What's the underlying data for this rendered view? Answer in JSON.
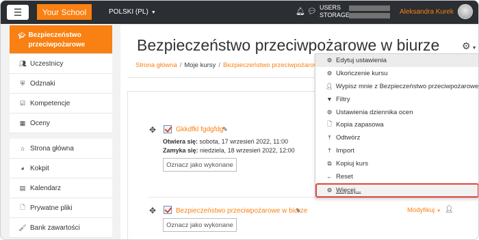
{
  "navbar": {
    "brand": "Your School",
    "language": "POLSKI (PL)",
    "usage_labels": [
      "USERS",
      "STORAGE"
    ],
    "username": "Aleksandra Kurek",
    "icons": {
      "menu": "hamburger-icon",
      "notifications": "bell-icon",
      "messages": "chat-icon"
    }
  },
  "sidebar": {
    "items": [
      {
        "label": "Bezpieczeństwo przeciwpożarowe",
        "icon": "graduation-cap-icon",
        "active": true
      },
      {
        "label": "Uczestnicy",
        "icon": "users-icon"
      },
      {
        "label": "Odznaki",
        "icon": "shield-icon"
      },
      {
        "label": "Kompetencje",
        "icon": "checkbox-icon"
      },
      {
        "label": "Oceny",
        "icon": "table-icon"
      },
      {
        "label": "Strona główna",
        "icon": "home-icon"
      },
      {
        "label": "Kokpit",
        "icon": "dashboard-icon"
      },
      {
        "label": "Kalendarz",
        "icon": "calendar-icon"
      },
      {
        "label": "Prywatne pliki",
        "icon": "file-icon"
      },
      {
        "label": "Bank zawartości",
        "icon": "brush-icon"
      }
    ]
  },
  "main": {
    "title": "Bezpieczeństwo przeciwpożarowe w biurze",
    "breadcrumb": [
      "Strona główna",
      "Moje kursy",
      "Bezpieczeństwo przeciwpożarowe"
    ],
    "activities": [
      {
        "name": "Gkkdfkl fgdgfdg",
        "opens_label": "Otwiera się:",
        "opens_value": "sobota, 17 wrzesień 2022, 11:00",
        "closes_label": "Zamyka się:",
        "closes_value": "niedziela, 18 wrzesień 2022, 12:00",
        "button": "Oznacz jako wykonane"
      },
      {
        "name": "Bezpieczeństwo przeciwpożarowe w biurze",
        "button": "Oznacz jako wykonane",
        "modify": "Modyfikuj"
      }
    ]
  },
  "dropdown": {
    "items": [
      {
        "label": "Edytuj ustawienia",
        "icon": "gear-icon"
      },
      {
        "label": "Ukończenie kursu",
        "icon": "check-circle-icon"
      },
      {
        "label": "Wypisz mnie z Bezpieczeństwo przeciwpożarowe",
        "icon": "user-icon"
      },
      {
        "label": "Filtry",
        "icon": "filter-icon"
      },
      {
        "label": "Ustawienia dziennika ocen",
        "icon": "gear-icon"
      },
      {
        "label": "Kopia zapasowa",
        "icon": "file-icon"
      },
      {
        "label": "Odtwórz",
        "icon": "upload-icon"
      },
      {
        "label": "Import",
        "icon": "upload-icon"
      },
      {
        "label": "Kopiuj kurs",
        "icon": "copy-icon"
      },
      {
        "label": "Reset",
        "icon": "arrow-left-icon"
      },
      {
        "label": "Więcej...",
        "icon": "gear-icon"
      }
    ]
  },
  "colors": {
    "accent": "#f98012",
    "navbar": "#2b2e32",
    "highlight_border": "#e0463a"
  }
}
